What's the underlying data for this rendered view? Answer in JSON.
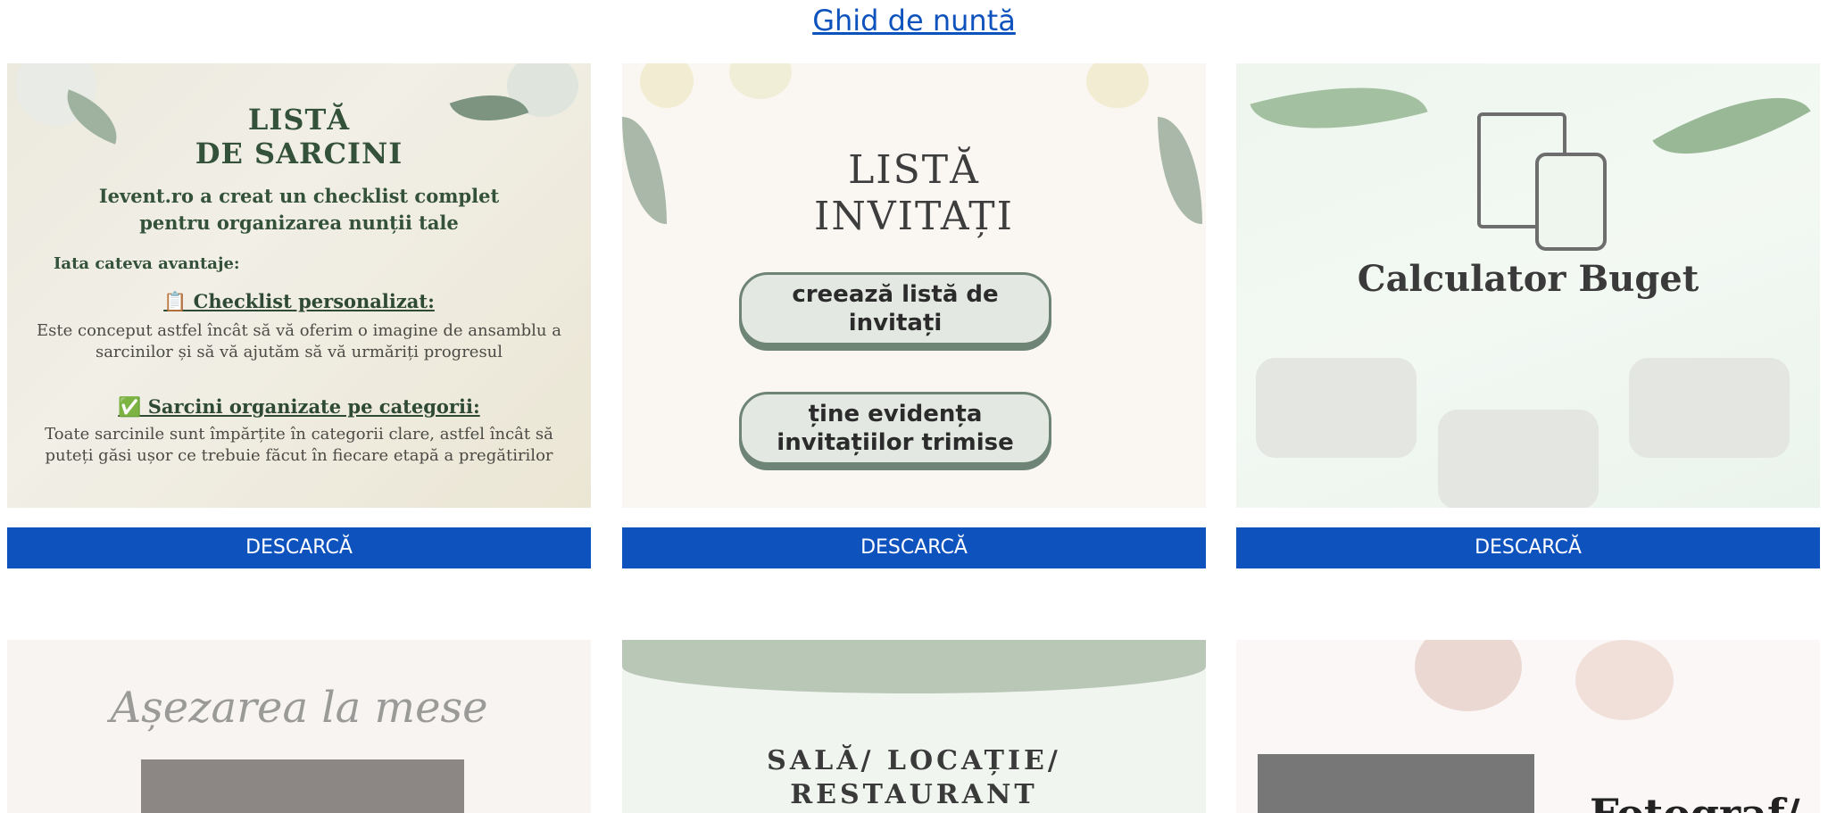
{
  "header": {
    "title": "Ghid de nuntă"
  },
  "download_label": "DESCARCĂ",
  "cards": {
    "tasks": {
      "title_line1": "LISTĂ",
      "title_line2": "DE SARCINI",
      "intro_line1": "Ievent.ro a creat un checklist complet",
      "intro_line2": "pentru organizarea nunții tale",
      "advantages": "Iata cateva avantaje:",
      "item1_title": "📋 Checklist personalizat:",
      "item1_text": "Este conceput astfel încât să vă oferim o imagine de ansamblu a sarcinilor și să vă ajutăm să vă urmăriți progresul",
      "item2_title": "✅ Sarcini organizate pe categorii:",
      "item2_text": "Toate sarcinile sunt împărțite în categorii clare, astfel încât să puteți găsi ușor ce trebuie făcut în fiecare etapă a pregătirilor"
    },
    "guests": {
      "title_line1": "LISTĂ",
      "title_line2": "INVITAȚI",
      "button1": "creează listă de invitați",
      "button2": "ține evidența invitațiilor trimise"
    },
    "budget": {
      "title": "Calculator Buget"
    },
    "seating": {
      "title": "Așezarea la mese"
    },
    "venue": {
      "title_line1": "SALĂ/ LOCAȚIE/",
      "title_line2": "RESTAURANT"
    },
    "photo": {
      "title": "Fotograf/"
    }
  },
  "colors": {
    "link": "#0e52bd",
    "button": "#0e52bd",
    "sage": "#6e8474"
  }
}
